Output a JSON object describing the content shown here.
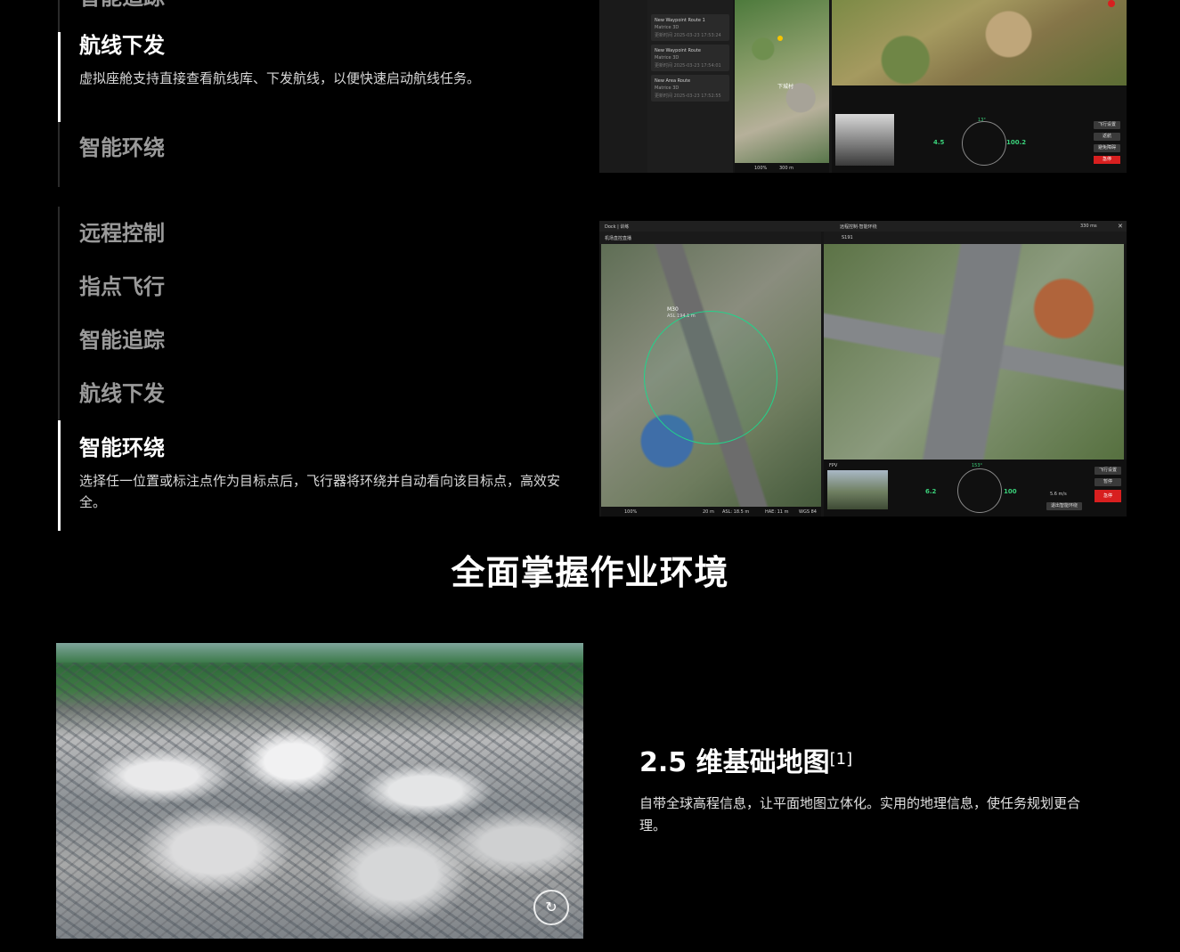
{
  "menu1": {
    "items": [
      {
        "label": "智能追踪",
        "active": false
      },
      {
        "label": "航线下发",
        "active": true,
        "desc": "虚拟座舱支持直接查看航线库、下发航线，以便快速启动航线任务。"
      },
      {
        "label": "智能环绕",
        "active": false
      }
    ]
  },
  "menu2": {
    "items": [
      {
        "label": "远程控制",
        "active": false
      },
      {
        "label": "指点飞行",
        "active": false
      },
      {
        "label": "智能追踪",
        "active": false
      },
      {
        "label": "航线下发",
        "active": false
      },
      {
        "label": "智能环绕",
        "active": true,
        "desc": "选择任一位置或标注点作为目标点后，飞行器将环绕并自动看向该目标点，高效安全。"
      }
    ]
  },
  "screenshot1": {
    "routes": [
      {
        "name": "New Waypoint Route 1",
        "drone": "Matrice 3D",
        "time": "更新时间 2025-03-23 17:53:24"
      },
      {
        "name": "New Waypoint Route",
        "drone": "Matrice 3D",
        "time": "更新时间 2025-03-23 17:54:01"
      },
      {
        "name": "New Area Route",
        "drone": "Matrice 3D",
        "time": "更新时间 2025-03-23 17:52:55"
      }
    ],
    "map_label": "下城村",
    "zoom": "100%",
    "scale": "300 m",
    "speed": "4.5",
    "alt": "100.2",
    "heading": "13°",
    "stop_label": "急停",
    "side_buttons": [
      "飞行设置",
      "返航",
      "避免障碍"
    ]
  },
  "screenshot2": {
    "title_left": "Dock | 训练",
    "title_center": "远程控制·智能环绕",
    "latency": "330 ms",
    "left_pane_title": "机场直控直播",
    "drone_label": "M30",
    "drone_sub": "ASL 194.1 m",
    "fov_label": "FPV",
    "right_tag": "S191",
    "speed": "6.2",
    "alt": "100",
    "heading": "153°",
    "zoom": "100%",
    "scale": "20 m",
    "asl": "ASL: 18.5 m",
    "hae": "HAE: 11 m",
    "wgs": "WGS 84",
    "stop_label": "急停",
    "side_buttons": [
      "飞行设置",
      "暂停",
      "退出智能环绕"
    ],
    "orbit_speed": "5.6 m/s"
  },
  "section_title": "全面掌握作业环境",
  "map_feature": {
    "title": "2.5 维基础地图",
    "footnote": "[1]",
    "desc": "自带全球高程信息，让平面地图立体化。实用的地理信息，使任务规划更合理。",
    "reset_icon": "reset-view-icon"
  }
}
